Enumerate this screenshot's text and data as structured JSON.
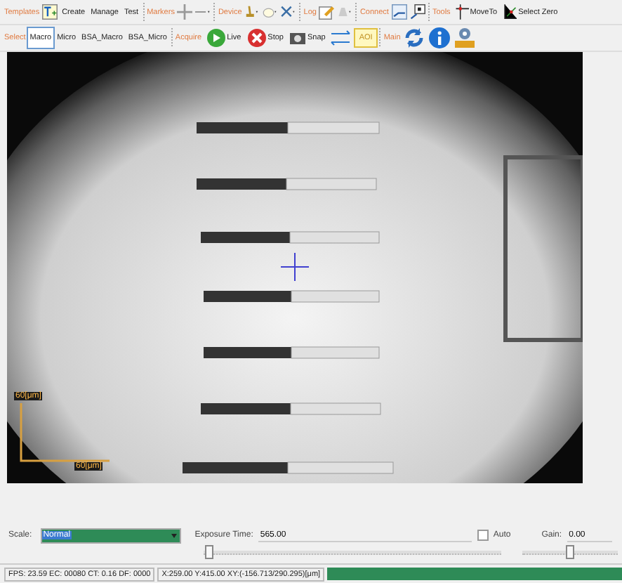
{
  "toolbar": {
    "templates": {
      "label": "Templates",
      "buttons": [
        "Create",
        "Manage",
        "Test"
      ]
    },
    "markers": {
      "label": "Markers"
    },
    "device": {
      "label": "Device"
    },
    "log": {
      "label": "Log"
    },
    "connect": {
      "label": "Connect"
    },
    "tools": {
      "label": "Tools",
      "buttons": [
        "MoveTo",
        "Select Zero"
      ]
    },
    "select": {
      "label": "Select",
      "options": [
        {
          "label": "Macro",
          "selected": true
        },
        {
          "label": "Micro",
          "selected": false
        },
        {
          "label": "BSA_Macro",
          "selected": false
        },
        {
          "label": "BSA_Micro",
          "selected": false
        }
      ]
    },
    "acquire": {
      "label": "Acquire",
      "buttons": [
        "Live",
        "Stop",
        "Snap"
      ],
      "aoi": {
        "label": "AOI",
        "on": true
      }
    },
    "main": {
      "label": "Main"
    }
  },
  "image": {
    "scale_labels": [
      "60[μm]",
      "60[μm]"
    ]
  },
  "controls": {
    "scale": {
      "label": "Scale:",
      "value": "Normal"
    },
    "exposure": {
      "label": "Exposure Time:",
      "value": "565.00",
      "level": 0.02
    },
    "auto": {
      "label": "Auto",
      "checked": false
    },
    "gain": {
      "label": "Gain:",
      "value": "0.00",
      "level": 0.5
    }
  },
  "status_bar": {
    "stats": "FPS: 23.59 EC: 00080 CT: 0.16 DF: 0000",
    "position": "X:259.00 Y:415.00 XY:(-156.713/290.295)[μm]",
    "progress": {
      "level": 1
    }
  }
}
